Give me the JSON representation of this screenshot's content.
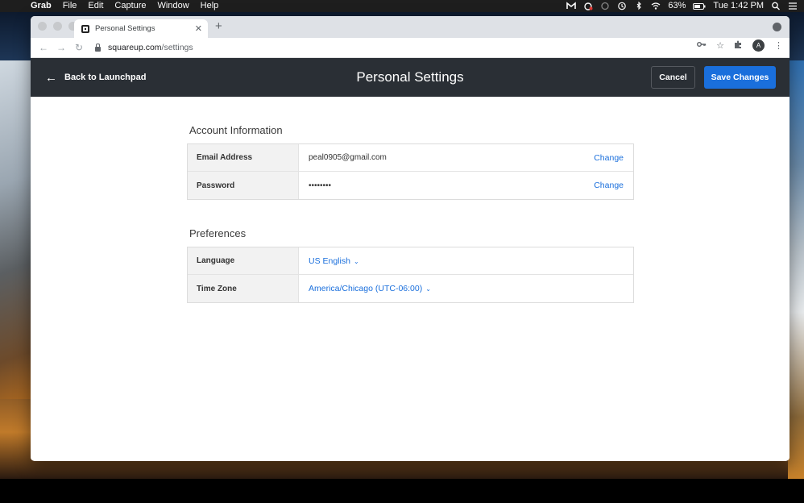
{
  "menubar": {
    "app": "Grab",
    "items": [
      "File",
      "Edit",
      "Capture",
      "Window",
      "Help"
    ],
    "battery": "63%",
    "clock": "Tue 1:42 PM"
  },
  "browser": {
    "tab_title": "Personal Settings",
    "url_host": "squareup.com",
    "url_path": "/settings",
    "profile_initial": "A"
  },
  "header": {
    "back_label": "Back to Launchpad",
    "title": "Personal Settings",
    "cancel_label": "Cancel",
    "save_label": "Save Changes"
  },
  "account": {
    "title": "Account Information",
    "rows": [
      {
        "label": "Email Address",
        "value": "peal0905@gmail.com",
        "action": "Change"
      },
      {
        "label": "Password",
        "value": "••••••••",
        "action": "Change"
      }
    ]
  },
  "preferences": {
    "title": "Preferences",
    "rows": [
      {
        "label": "Language",
        "value": "US English"
      },
      {
        "label": "Time Zone",
        "value": "America/Chicago (UTC-06:00)"
      }
    ]
  }
}
